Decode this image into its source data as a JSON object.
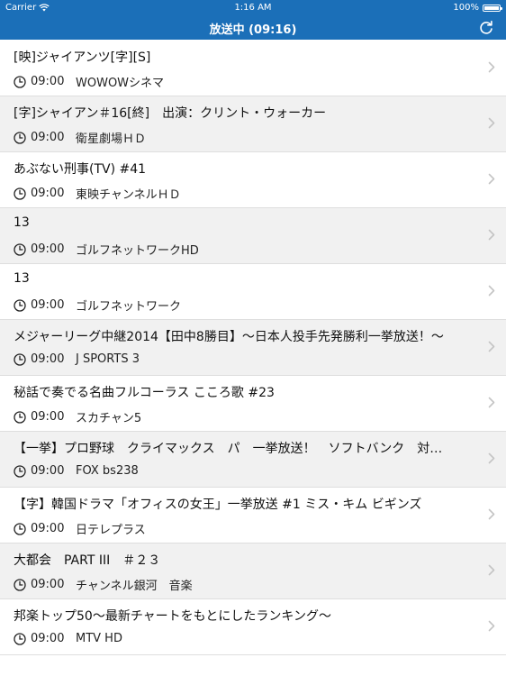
{
  "statusbar": {
    "carrier": "Carrier",
    "time": "1:16 AM",
    "battery_text": "100%",
    "battery_level": 1.0
  },
  "navbar": {
    "title": "放送中 (09:16)",
    "refresh_icon": "refresh-icon"
  },
  "items": [
    {
      "title": "[映]ジャイアンツ[字][S]",
      "time": "09:00",
      "channel": "WOWOWシネマ"
    },
    {
      "title": "[字]シャイアン＃16[終]　出演：クリント・ウォーカー",
      "time": "09:00",
      "channel": "衛星劇場ＨＤ"
    },
    {
      "title": "あぶない刑事(TV) #41",
      "time": "09:00",
      "channel": "東映チャンネルＨＤ"
    },
    {
      "title": "13",
      "time": "09:00",
      "channel": "ゴルフネットワークHD"
    },
    {
      "title": "13",
      "time": "09:00",
      "channel": "ゴルフネットワーク"
    },
    {
      "title": "メジャーリーグ中継2014【田中8勝目】〜日本人投手先発勝利一挙放送！〜",
      "time": "09:00",
      "channel": "J SPORTS 3"
    },
    {
      "title": "秘話で奏でる名曲フルコーラス こころ歌 #23",
      "time": "09:00",
      "channel": "スカチャン5"
    },
    {
      "title": "【一挙】プロ野球　クライマックス　パ　一挙放送！　ソフトバンク　対…",
      "time": "09:00",
      "channel": "FOX bs238"
    },
    {
      "title": "【字】韓国ドラマ「オフィスの女王」一挙放送 #1 ミス・キム ビギンズ",
      "time": "09:00",
      "channel": "日テレプラス"
    },
    {
      "title": "大都会　PART III　＃２３",
      "time": "09:00",
      "channel": "チャンネル銀河　音楽"
    },
    {
      "title": "邦楽トップ50〜最新チャートをもとにしたランキング〜",
      "time": "09:00",
      "channel": "MTV HD"
    }
  ]
}
